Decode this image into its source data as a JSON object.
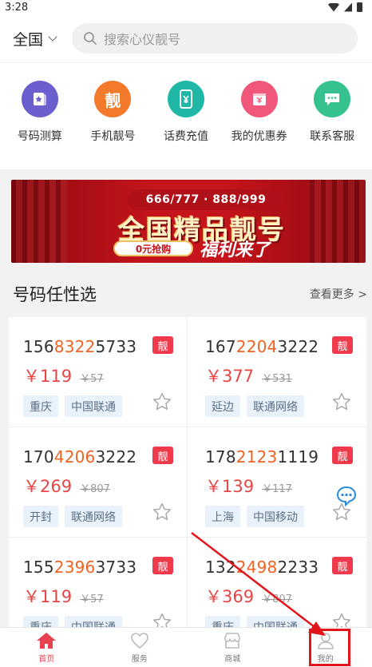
{
  "status_bar": {
    "time": "3:28"
  },
  "header": {
    "region": "全国",
    "search_placeholder": "搜索心仪靓号"
  },
  "quick_nav": [
    {
      "label": "号码测算",
      "icon": "star-card-icon",
      "color": "#6b5fcf"
    },
    {
      "label": "手机靓号",
      "icon": "liang-icon",
      "glyph": "靓",
      "color": "#f47a2b"
    },
    {
      "label": "话费充值",
      "icon": "phone-yen-icon",
      "color": "#1fb7a6"
    },
    {
      "label": "我的优惠券",
      "icon": "coupon-icon",
      "color": "#f0577a"
    },
    {
      "label": "联系客服",
      "icon": "chat-icon",
      "color": "#35c28e"
    }
  ],
  "banner": {
    "top_text": "666/777 · 888/999",
    "main_text": "全国精品靓号",
    "pill_text": "0元抢购",
    "side_text": "福利来了"
  },
  "section": {
    "title": "号码任性选",
    "more": "查看更多 >"
  },
  "numbers": [
    {
      "pre": "156",
      "hl": "8322",
      "post": "5733",
      "badge": "靓",
      "price": "￥119",
      "old": "￥57",
      "tags": [
        "重庆",
        "中国联通"
      ]
    },
    {
      "pre": "167",
      "hl": "2204",
      "post": "3222",
      "badge": "靓",
      "price": "￥377",
      "old": "￥531",
      "tags": [
        "延边",
        "联通网络"
      ]
    },
    {
      "pre": "170",
      "hl": "4206",
      "post": "3222",
      "badge": "靓",
      "price": "￥269",
      "old": "￥807",
      "tags": [
        "开封",
        "联通网络"
      ]
    },
    {
      "pre": "178",
      "hl": "2123",
      "post": "1119",
      "badge": "靓",
      "price": "￥139",
      "old": "￥117",
      "tags": [
        "上海",
        "中国移动"
      ]
    },
    {
      "pre": "155",
      "hl": "2396",
      "post": "3733",
      "badge": "靓",
      "price": "￥119",
      "old": "￥57",
      "tags": [
        "重庆",
        "中国联通"
      ]
    },
    {
      "pre": "132",
      "hl": "2498",
      "post": "2233",
      "badge": "靓",
      "price": "￥369",
      "old": "￥807",
      "tags": [
        "重庆",
        "中国联通"
      ]
    }
  ],
  "tabbar": [
    {
      "label": "首页",
      "icon": "home-icon",
      "active": true
    },
    {
      "label": "服务",
      "icon": "heart-icon",
      "active": false
    },
    {
      "label": "商城",
      "icon": "shop-icon",
      "active": false
    },
    {
      "label": "我的",
      "icon": "user-icon",
      "active": false
    }
  ],
  "colors": {
    "accent": "#e8414f",
    "highlight_digits": "#f06322",
    "price": "#e84545",
    "annotation": "#e2141c"
  }
}
